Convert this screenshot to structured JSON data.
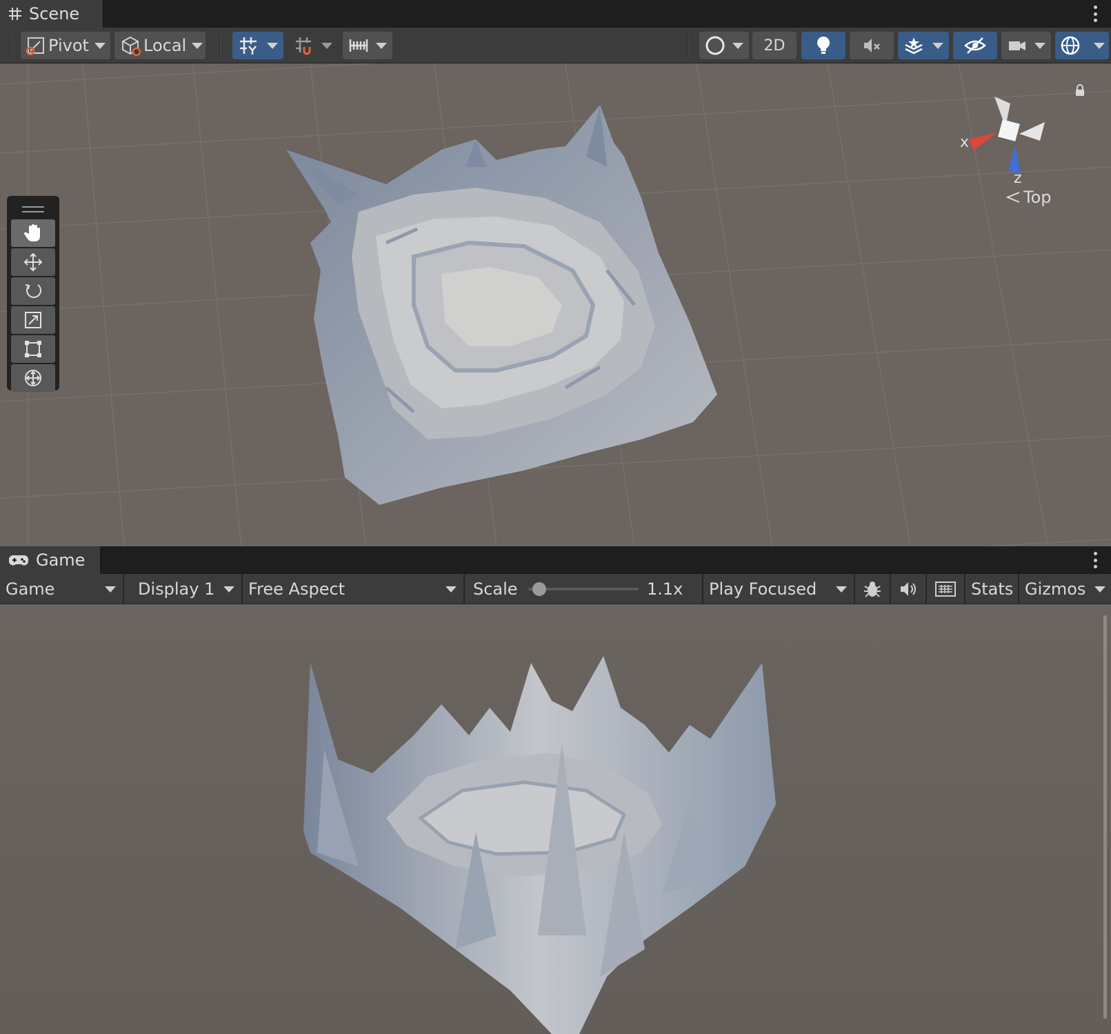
{
  "scene": {
    "tab_label": "Scene",
    "pivot_label": "Pivot",
    "local_label": "Local",
    "mode_2d_label": "2D",
    "orientation": {
      "axis_x": "x",
      "axis_z": "z",
      "view_label": "Top"
    },
    "tools": [
      {
        "icon": "hand-icon"
      },
      {
        "icon": "move-icon"
      },
      {
        "icon": "rotate-icon"
      },
      {
        "icon": "scale-icon"
      },
      {
        "icon": "rect-icon"
      },
      {
        "icon": "transform-icon"
      }
    ]
  },
  "game": {
    "tab_label": "Game",
    "view_dropdown": "Game",
    "display_dropdown": "Display 1",
    "aspect_dropdown": "Free Aspect",
    "scale_label": "Scale",
    "scale_value": "1.1x",
    "scale_fraction": 0.1,
    "play_mode_dropdown": "Play Focused",
    "stats_label": "Stats",
    "gizmos_label": "Gizmos"
  },
  "colors": {
    "viewport_bg": "#6b645f",
    "toggle_active": "#3a5c88",
    "terrain": "#c9cdd4",
    "terrain_shadow": "#6a7890",
    "axis_x": "#d9473e",
    "axis_z": "#3f6fd8"
  }
}
